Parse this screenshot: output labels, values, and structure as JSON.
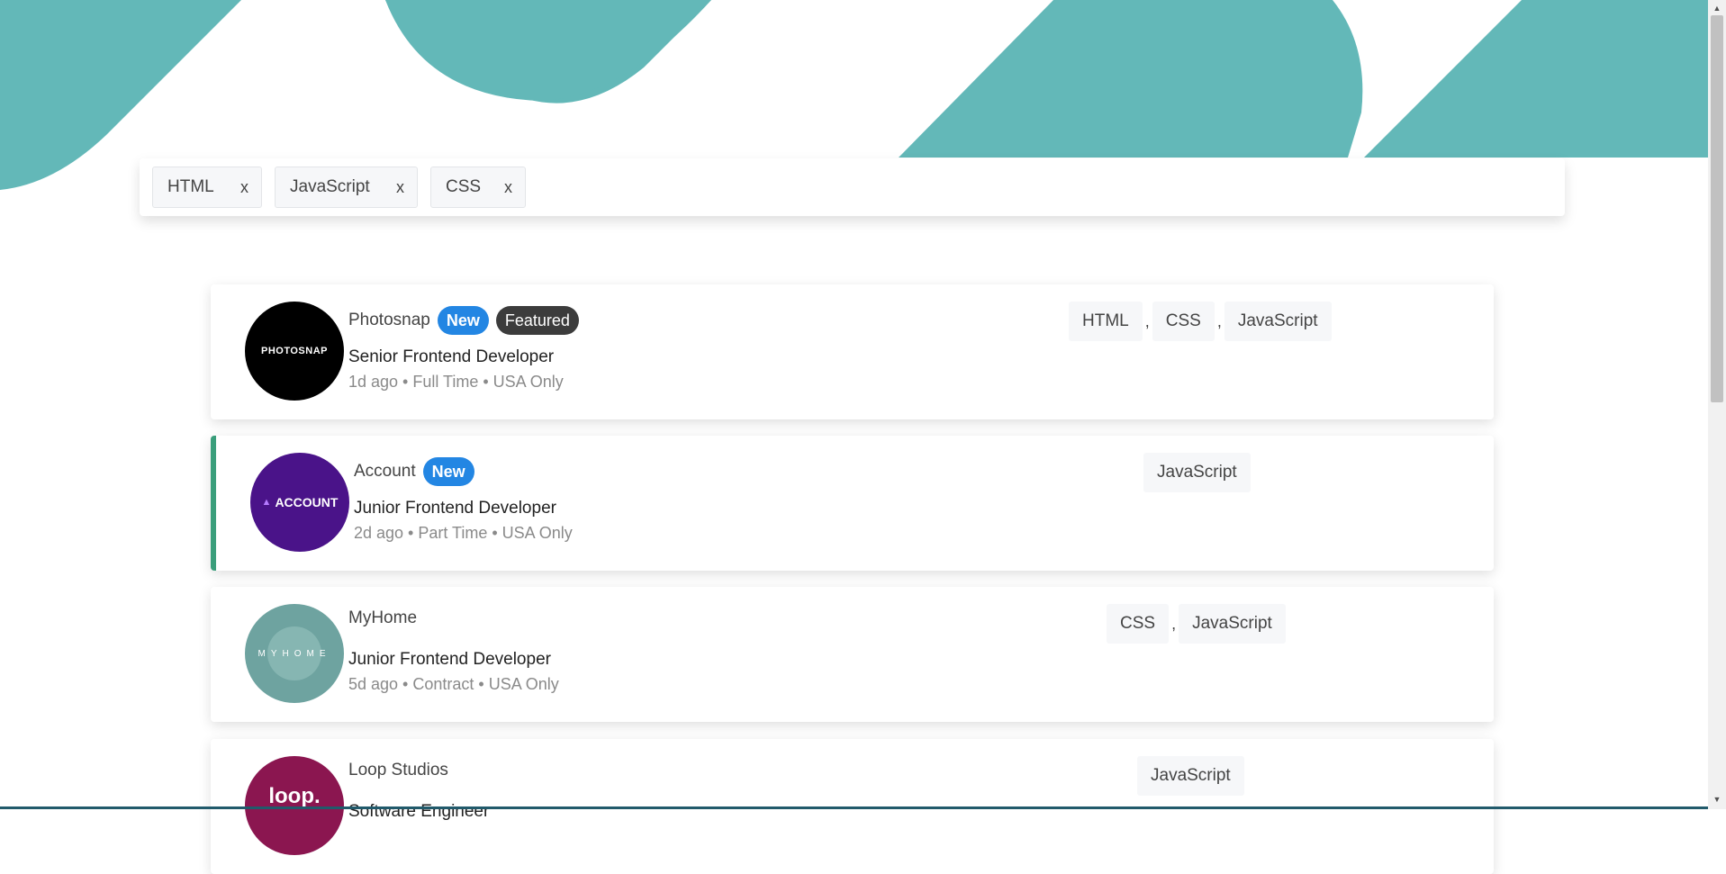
{
  "colors": {
    "accent": "#63b8b8",
    "new_badge": "#2386e3",
    "featured_badge": "#3c3c3c",
    "featured_border": "#3a9e7b"
  },
  "filters": [
    {
      "label": "HTML",
      "remove": "x"
    },
    {
      "label": "JavaScript",
      "remove": "x"
    },
    {
      "label": "CSS",
      "remove": "x"
    }
  ],
  "jobs": [
    {
      "logo_text": "PHOTOSNAP",
      "company": "Photosnap",
      "new_label": "New",
      "featured_label": "Featured",
      "position": "Senior Frontend Developer",
      "meta": "1d ago • Full Time • USA Only",
      "tags": [
        "HTML",
        "CSS",
        "JavaScript"
      ],
      "separator": ","
    },
    {
      "logo_text": "ACCOUNT",
      "company": "Account",
      "new_label": "New",
      "position": "Junior Frontend Developer",
      "meta": "2d ago • Part Time • USA Only",
      "tags": [
        "JavaScript"
      ]
    },
    {
      "logo_text": "MYHOME",
      "company": "MyHome",
      "position": "Junior Frontend Developer",
      "meta": "5d ago • Contract • USA Only",
      "tags": [
        "CSS",
        "JavaScript"
      ],
      "separator": ","
    },
    {
      "logo_text": "loop.",
      "company": "Loop Studios",
      "position": "Software Engineer",
      "tags": [
        "JavaScript"
      ]
    }
  ],
  "scrollbar": {
    "up": "▲",
    "down": "▼"
  }
}
